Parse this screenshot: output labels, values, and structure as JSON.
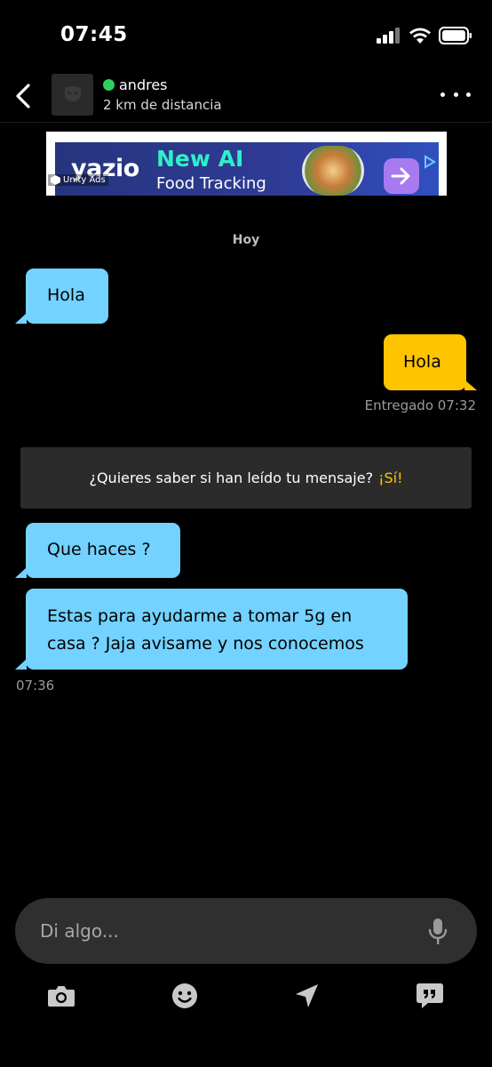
{
  "status": {
    "time": "07:45"
  },
  "header": {
    "user_name": "andres",
    "distance": "2 km de distancia",
    "online_color": "#2fd15b"
  },
  "ad": {
    "brand": "yazio",
    "headline": "New AI",
    "subline": "Food Tracking",
    "network": "Unity Ads"
  },
  "chat": {
    "day_label": "Hoy",
    "messages": [
      {
        "direction": "in",
        "text": "Hola"
      },
      {
        "direction": "out",
        "text": "Hola"
      },
      {
        "direction": "in",
        "text": "Que haces ?"
      },
      {
        "direction": "in",
        "text_line1": "Estas para ayudarme a tomar 5g en",
        "text_line2": "casa ? Jaja avisame y nos conocemos"
      }
    ],
    "delivered_status": "Entregado 07:32",
    "last_in_time": "07:36",
    "read_prompt": "¿Quieres saber si han leído tu mensaje?",
    "read_cta": "¡Sí!"
  },
  "composer": {
    "placeholder": "Di algo..."
  },
  "colors": {
    "incoming_bubble": "#73d2ff",
    "outgoing_bubble": "#ffc400",
    "background": "#000000",
    "accent": "#ffc400"
  },
  "toolbar": {
    "icons": [
      "camera-icon",
      "emoji-icon",
      "location-icon",
      "quote-icon"
    ]
  }
}
